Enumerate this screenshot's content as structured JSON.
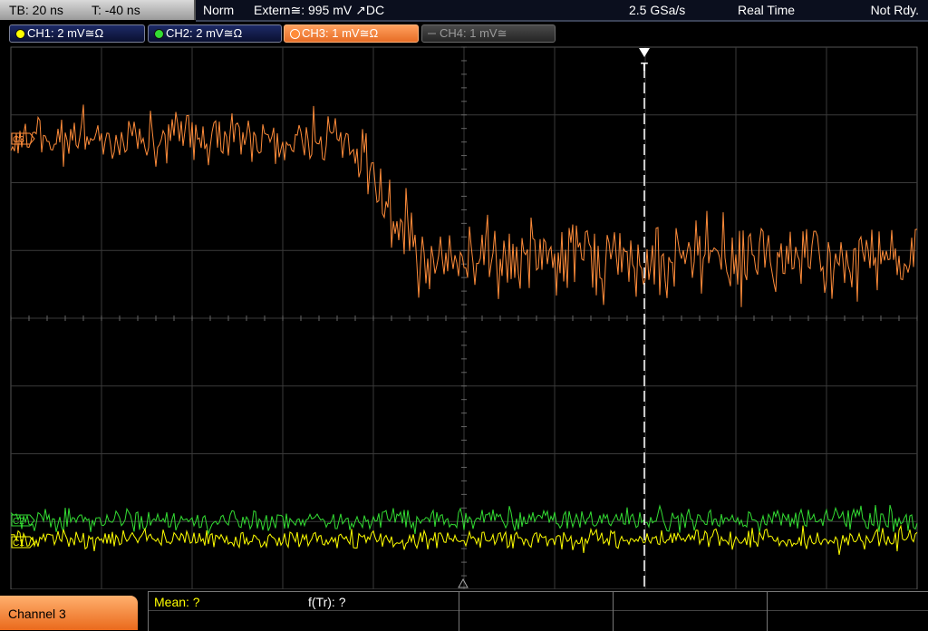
{
  "timebase": {
    "tb": "TB: 20 ns",
    "trigger_pos": "T: -40 ns"
  },
  "status": {
    "mode": "Norm",
    "trigger": "Extern≅: 995 mV ↗DC",
    "sample_rate": "2.5 GSa/s",
    "acquisition": "Real Time",
    "state": "Not Rdy."
  },
  "channels": [
    {
      "label": "CH1: 2 mV≅Ω",
      "color": "#ffff00",
      "active": true
    },
    {
      "label": "CH2: 2 mV≅Ω",
      "color": "#33dd33",
      "active": true
    },
    {
      "label": "CH3: 1 mV≅Ω",
      "color": "#ff8c3a",
      "active": true,
      "selected": true
    },
    {
      "label": "CH4: 1 mV≅",
      "color": "#777777",
      "active": false
    }
  ],
  "markers": {
    "ch3": "C3",
    "ch2": "C2",
    "ch1": "C1",
    "trigger": "T"
  },
  "colors": {
    "ch1": "#ffff00",
    "ch2": "#33dd33",
    "ch3": "#ff8c3a",
    "grid": "#3a3a3a"
  },
  "bottom": {
    "channel_label": "Channel 3",
    "mean": "Mean: ?",
    "ftr": "f(Tr): ?"
  }
}
